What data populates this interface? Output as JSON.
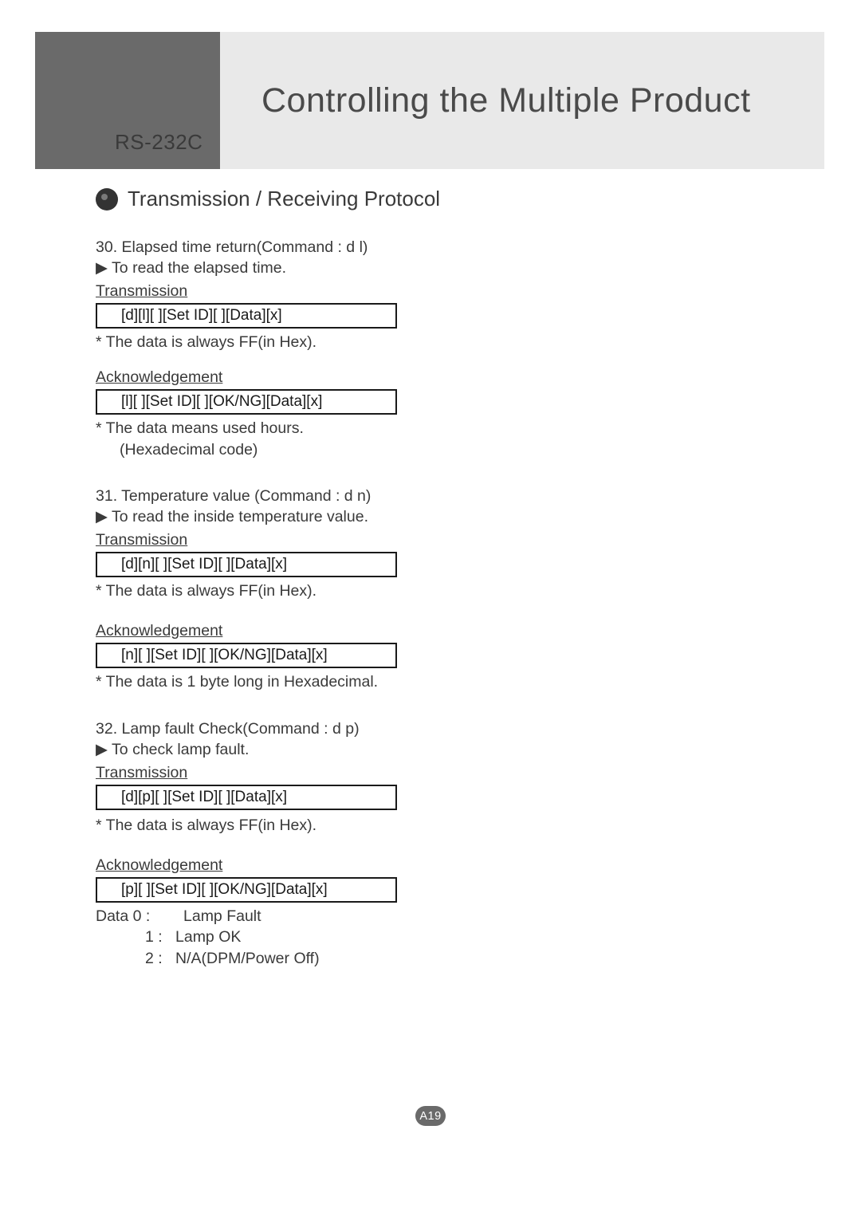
{
  "header": {
    "rs_label": "RS-232C",
    "title": "Controlling the Multiple Product"
  },
  "section_title": "Transmission / Receiving Protocol",
  "cmd30": {
    "title": "30. Elapsed time return(Command : d l)",
    "desc": "▶ To read the elapsed time.",
    "tx_label": "Transmission",
    "tx_box": "[d][l][ ][Set ID][ ][Data][x]",
    "tx_note": " * The data is always FF(in Hex).",
    "ack_label": "Acknowledgement",
    "ack_box": "[l][ ][Set ID][ ][OK/NG][Data][x]",
    "ack_note1": " * The data means used hours.",
    "ack_note2": "(Hexadecimal code)"
  },
  "cmd31": {
    "title": "31. Temperature value (Command : d n)",
    "desc": "▶ To read the inside temperature value.",
    "tx_label": "Transmission",
    "tx_box": "[d][n][ ][Set ID][ ][Data][x]",
    "tx_note": "* The data is always FF(in Hex).",
    "ack_label": "Acknowledgement",
    "ack_box": "[n][ ][Set ID][ ][OK/NG][Data][x]",
    "ack_note1": "* The data  is 1 byte long in Hexadecimal."
  },
  "cmd32": {
    "title": "32. Lamp fault Check(Command : d p)",
    "desc": "▶ To check lamp fault.",
    "tx_label": "Transmission",
    "tx_box": "[d][p][ ][Set ID][ ][Data][x]",
    "tx_note": "* The data is always FF(in Hex).",
    "ack_label": "Acknowledgement",
    "ack_box": "[p][ ][Set ID][ ][OK/NG][Data][x]",
    "data_rows": [
      {
        "k": "Data 0 :",
        "v": "Lamp Fault"
      },
      {
        "k": "1 :",
        "v": "Lamp OK"
      },
      {
        "k": "2 :",
        "v": "N/A(DPM/Power Off)"
      }
    ]
  },
  "page_label": "A19"
}
